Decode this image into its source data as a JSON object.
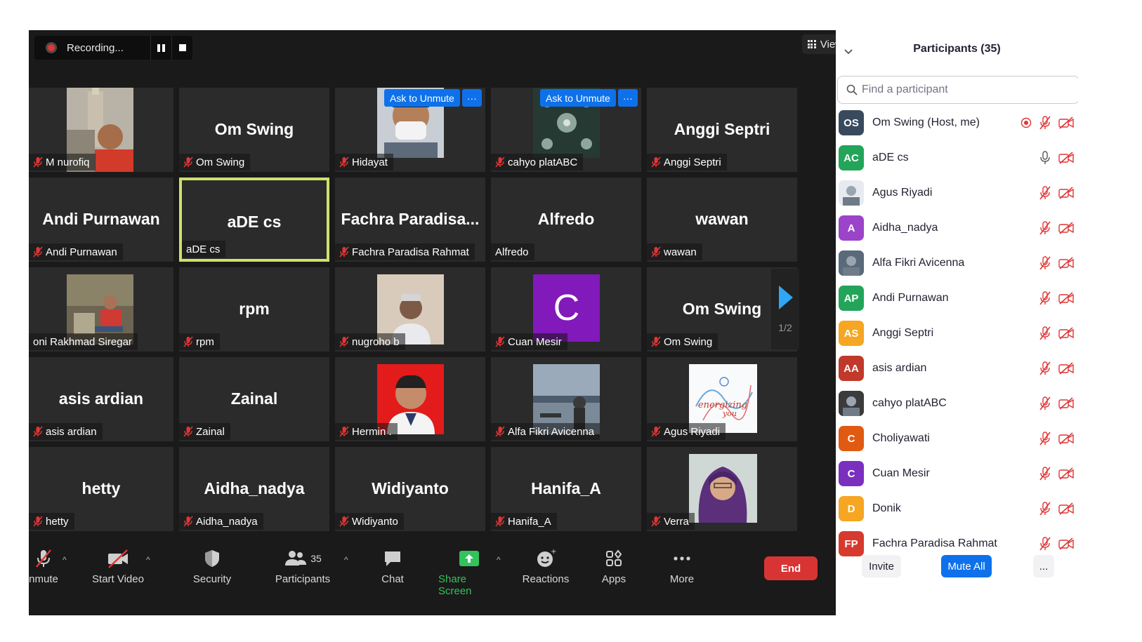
{
  "recording": {
    "label": "Recording..."
  },
  "view_button": {
    "label": "View"
  },
  "tiles": [
    {
      "big": "",
      "label": "M nurofiq",
      "muted": true,
      "photo": "man-with-tower"
    },
    {
      "big": "Om Swing",
      "label": "Om Swing",
      "muted": true
    },
    {
      "big": "",
      "label": "Hidayat",
      "muted": true,
      "photo": "man-with-mask",
      "ask": true
    },
    {
      "big": "",
      "label": "cahyo platABC",
      "muted": true,
      "photo": "pattern",
      "ask": true
    },
    {
      "big": "Anggi Septri",
      "label": "Anggi Septri",
      "muted": true
    },
    {
      "big": "Andi Purnawan",
      "label": "Andi Purnawan",
      "muted": true
    },
    {
      "big": "aDE cs",
      "label": "aDE cs",
      "muted": false,
      "active": true
    },
    {
      "big": "Fachra  Paradisa...",
      "label": "Fachra Paradisa Rahmat",
      "muted": true
    },
    {
      "big": "Alfredo",
      "label": "Alfredo",
      "muted": false
    },
    {
      "big": "wawan",
      "label": "wawan",
      "muted": true
    },
    {
      "big": "",
      "label": "oni Rakhmad Siregar",
      "muted": false,
      "photo": "man-sitting"
    },
    {
      "big": "rpm",
      "label": "rpm",
      "muted": true
    },
    {
      "big": "",
      "label": "nugroho b",
      "muted": true,
      "photo": "man-portrait"
    },
    {
      "big": "",
      "label": "Cuan Mesir",
      "muted": true,
      "letter": "C"
    },
    {
      "big": "Om Swing",
      "label": "Om Swing",
      "muted": true
    },
    {
      "big": "asis ardian",
      "label": "asis ardian",
      "muted": true
    },
    {
      "big": "Zainal",
      "label": "Zainal",
      "muted": true
    },
    {
      "big": "",
      "label": "Hermin .",
      "muted": true,
      "photo": "red-portrait"
    },
    {
      "big": "",
      "label": "Alfa Fikri Avicenna",
      "muted": true,
      "photo": "sea"
    },
    {
      "big": "",
      "label": "Agus Riyadi",
      "muted": true,
      "photo": "energizing"
    },
    {
      "big": "hetty",
      "label": "hetty",
      "muted": true
    },
    {
      "big": "Aidha_nadya",
      "label": "Aidha_nadya",
      "muted": true
    },
    {
      "big": "Widiyanto",
      "label": "Widiyanto",
      "muted": true
    },
    {
      "big": "Hanifa_A",
      "label": "Hanifa_A",
      "muted": true
    },
    {
      "big": "",
      "label": "Verra",
      "muted": true,
      "photo": "woman-hijab"
    }
  ],
  "ask_unmute_label": "Ask to Unmute",
  "ask_more_label": "···",
  "energizing_text": "energizing you",
  "cuan_letter": "C",
  "page_indicator": "1/2",
  "toolbar": {
    "unmute": "nmute",
    "start_video": "Start Video",
    "security": "Security",
    "participants": "Participants",
    "participants_count": "35",
    "chat": "Chat",
    "share_screen": "Share Screen",
    "reactions": "Reactions",
    "apps": "Apps",
    "more": "More",
    "end": "End"
  },
  "panel": {
    "title": "Participants (35)",
    "search_placeholder": "Find a participant",
    "invite": "Invite",
    "mute_all": "Mute All",
    "more": "...",
    "participants": [
      {
        "initials": "OS",
        "name": "Om Swing (Host, me)",
        "color": "#3a4a5e",
        "rec": true,
        "mic": "muted"
      },
      {
        "initials": "AC",
        "name": "aDE cs",
        "color": "#23a559",
        "mic": "on"
      },
      {
        "initials": "",
        "name": "Agus Riyadi",
        "color": "#e7eaf0",
        "photo": true,
        "mic": "muted"
      },
      {
        "initials": "A",
        "name": "Aidha_nadya",
        "color": "#9b44c9",
        "mic": "muted"
      },
      {
        "initials": "",
        "name": "Alfa Fikri Avicenna",
        "color": "#5a6a7a",
        "photo": true,
        "mic": "muted"
      },
      {
        "initials": "AP",
        "name": "Andi Purnawan",
        "color": "#23a559",
        "mic": "muted"
      },
      {
        "initials": "AS",
        "name": "Anggi Septri",
        "color": "#f5a623",
        "mic": "muted"
      },
      {
        "initials": "AA",
        "name": "asis ardian",
        "color": "#c0392b",
        "mic": "muted"
      },
      {
        "initials": "",
        "name": "cahyo platABC",
        "color": "#3b3b3b",
        "photo": true,
        "mic": "muted"
      },
      {
        "initials": "C",
        "name": "Choliyawati",
        "color": "#e05a12",
        "mic": "muted"
      },
      {
        "initials": "C",
        "name": "Cuan Mesir",
        "color": "#7b2fbe",
        "mic": "muted"
      },
      {
        "initials": "D",
        "name": "Donik",
        "color": "#f5a623",
        "mic": "muted"
      },
      {
        "initials": "FP",
        "name": "Fachra Paradisa Rahmat",
        "color": "#d63a2f",
        "mic": "muted"
      }
    ]
  }
}
